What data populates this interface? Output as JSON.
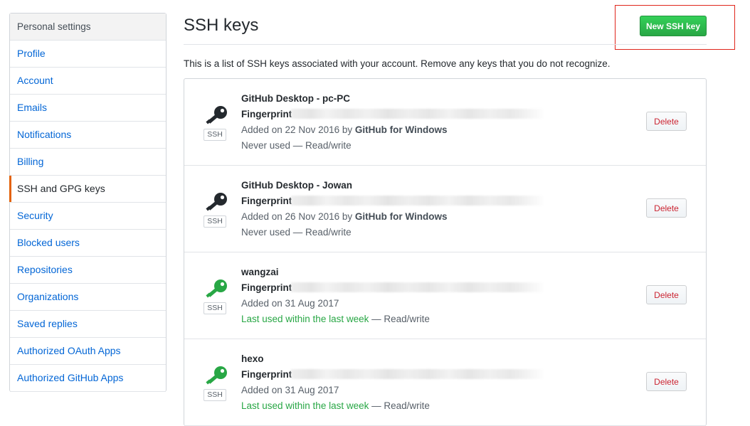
{
  "sidebar": {
    "heading": "Personal settings",
    "items": [
      {
        "label": "Profile"
      },
      {
        "label": "Account"
      },
      {
        "label": "Emails"
      },
      {
        "label": "Notifications"
      },
      {
        "label": "Billing"
      },
      {
        "label": "SSH and GPG keys",
        "selected": true
      },
      {
        "label": "Security"
      },
      {
        "label": "Blocked users"
      },
      {
        "label": "Repositories"
      },
      {
        "label": "Organizations"
      },
      {
        "label": "Saved replies"
      },
      {
        "label": "Authorized OAuth Apps"
      },
      {
        "label": "Authorized GitHub Apps"
      }
    ]
  },
  "main": {
    "title": "SSH keys",
    "new_key_label": "New SSH key",
    "intro": "This is a list of SSH keys associated with your account. Remove any keys that you do not recognize.",
    "badge_label": "SSH",
    "fingerprint_label": "Fingerprint",
    "delete_label": "Delete",
    "keys": [
      {
        "title": "GitHub Desktop - pc-PC",
        "added": "Added on 22 Nov 2016 by ",
        "added_by": "GitHub for Windows",
        "usage_prefix": "",
        "usage_main": "Never used",
        "usage_suffix": " — Read/write",
        "icon_color": "#24292e"
      },
      {
        "title": "GitHub Desktop - Jowan",
        "added": "Added on 26 Nov 2016 by ",
        "added_by": "GitHub for Windows",
        "usage_prefix": "",
        "usage_main": "Never used",
        "usage_suffix": " — Read/write",
        "icon_color": "#24292e"
      },
      {
        "title": "wangzai",
        "added": "Added on 31 Aug 2017",
        "added_by": "",
        "usage_prefix": "Last used within the last week",
        "usage_main": "",
        "usage_suffix": " — Read/write",
        "icon_color": "#28a745"
      },
      {
        "title": "hexo",
        "added": "Added on 31 Aug 2017",
        "added_by": "",
        "usage_prefix": "Last used within the last week",
        "usage_main": "",
        "usage_suffix": " — Read/write",
        "icon_color": "#28a745"
      }
    ]
  }
}
